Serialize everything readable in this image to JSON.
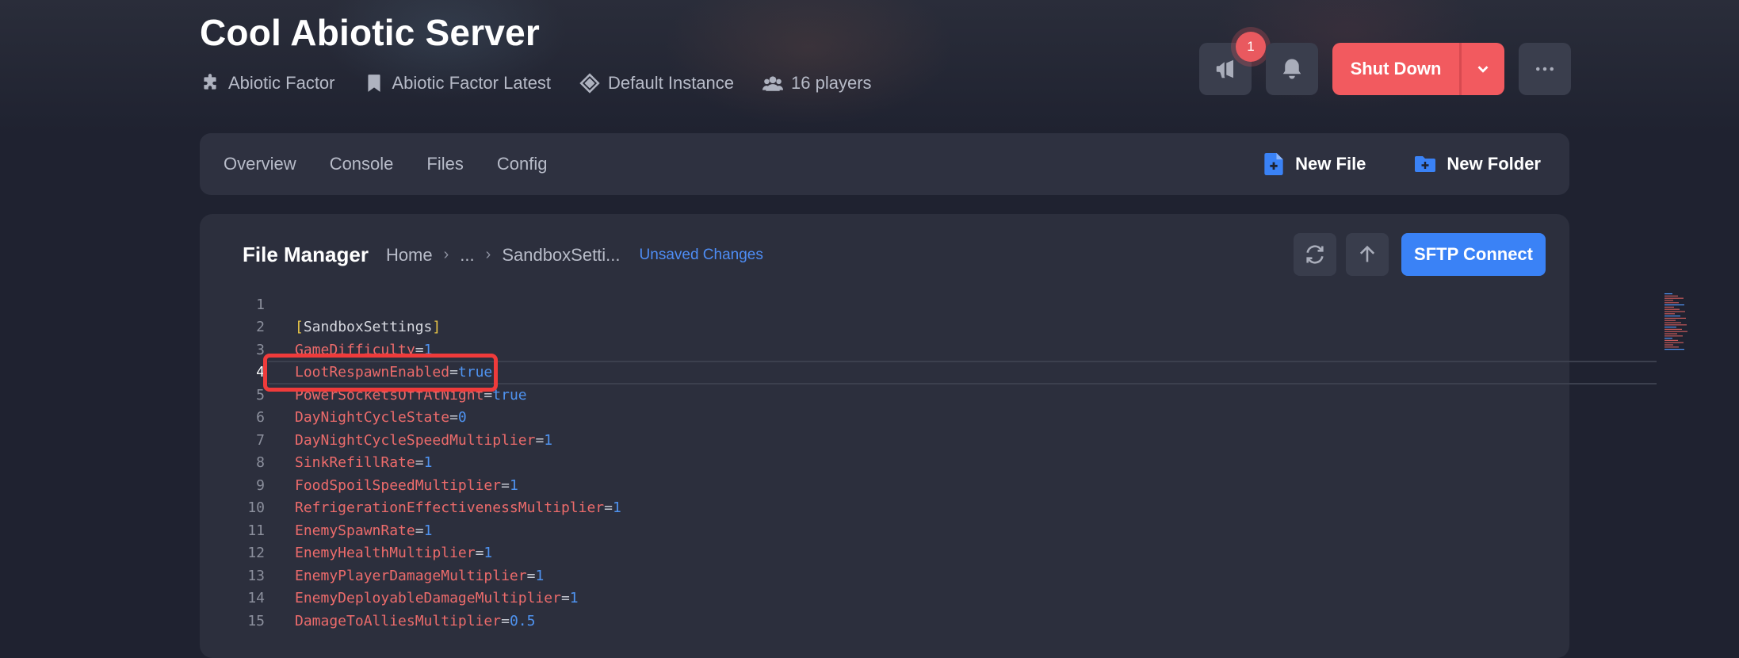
{
  "server": {
    "title": "Cool Abiotic Server",
    "meta": [
      {
        "icon": "puzzle-icon",
        "label": "Abiotic Factor"
      },
      {
        "icon": "bookmark-icon",
        "label": "Abiotic Factor Latest"
      },
      {
        "icon": "layers-icon",
        "label": "Default Instance"
      },
      {
        "icon": "users-icon",
        "label": "16 players"
      }
    ]
  },
  "header_actions": {
    "announcement_badge": "1",
    "shut_down_label": "Shut Down",
    "accent_color": "#f25a5f"
  },
  "nav": {
    "tabs": [
      "Overview",
      "Console",
      "Files",
      "Config"
    ],
    "new_file_label": "New File",
    "new_folder_label": "New Folder"
  },
  "file_manager": {
    "title": "File Manager",
    "breadcrumb": [
      "Home",
      "...",
      "SandboxSetti..."
    ],
    "unsaved_label": "Unsaved Changes",
    "sftp_label": "SFTP Connect"
  },
  "editor": {
    "active_line": 4,
    "lines": [
      {
        "n": "1",
        "key": "",
        "eq": "",
        "val": "",
        "section": ""
      },
      {
        "n": "2",
        "key": "",
        "eq": "",
        "val": "",
        "section": "SandboxSettings"
      },
      {
        "n": "3",
        "key": "GameDifficulty",
        "eq": "=",
        "val": "1",
        "section": ""
      },
      {
        "n": "4",
        "key": "LootRespawnEnabled",
        "eq": "=",
        "val": "true",
        "section": ""
      },
      {
        "n": "5",
        "key": "PowerSocketsOffAtNight",
        "eq": "=",
        "val": "true",
        "section": ""
      },
      {
        "n": "6",
        "key": "DayNightCycleState",
        "eq": "=",
        "val": "0",
        "section": ""
      },
      {
        "n": "7",
        "key": "DayNightCycleSpeedMultiplier",
        "eq": "=",
        "val": "1",
        "section": ""
      },
      {
        "n": "8",
        "key": "SinkRefillRate",
        "eq": "=",
        "val": "1",
        "section": ""
      },
      {
        "n": "9",
        "key": "FoodSpoilSpeedMultiplier",
        "eq": "=",
        "val": "1",
        "section": ""
      },
      {
        "n": "10",
        "key": "RefrigerationEffectivenessMultiplier",
        "eq": "=",
        "val": "1",
        "section": ""
      },
      {
        "n": "11",
        "key": "EnemySpawnRate",
        "eq": "=",
        "val": "1",
        "section": ""
      },
      {
        "n": "12",
        "key": "EnemyHealthMultiplier",
        "eq": "=",
        "val": "1",
        "section": ""
      },
      {
        "n": "13",
        "key": "EnemyPlayerDamageMultiplier",
        "eq": "=",
        "val": "1",
        "section": ""
      },
      {
        "n": "14",
        "key": "EnemyDeployableDamageMultiplier",
        "eq": "=",
        "val": "1",
        "section": ""
      },
      {
        "n": "15",
        "key": "DamageToAlliesMultiplier",
        "eq": "=",
        "val": "0.5",
        "section": ""
      }
    ]
  }
}
